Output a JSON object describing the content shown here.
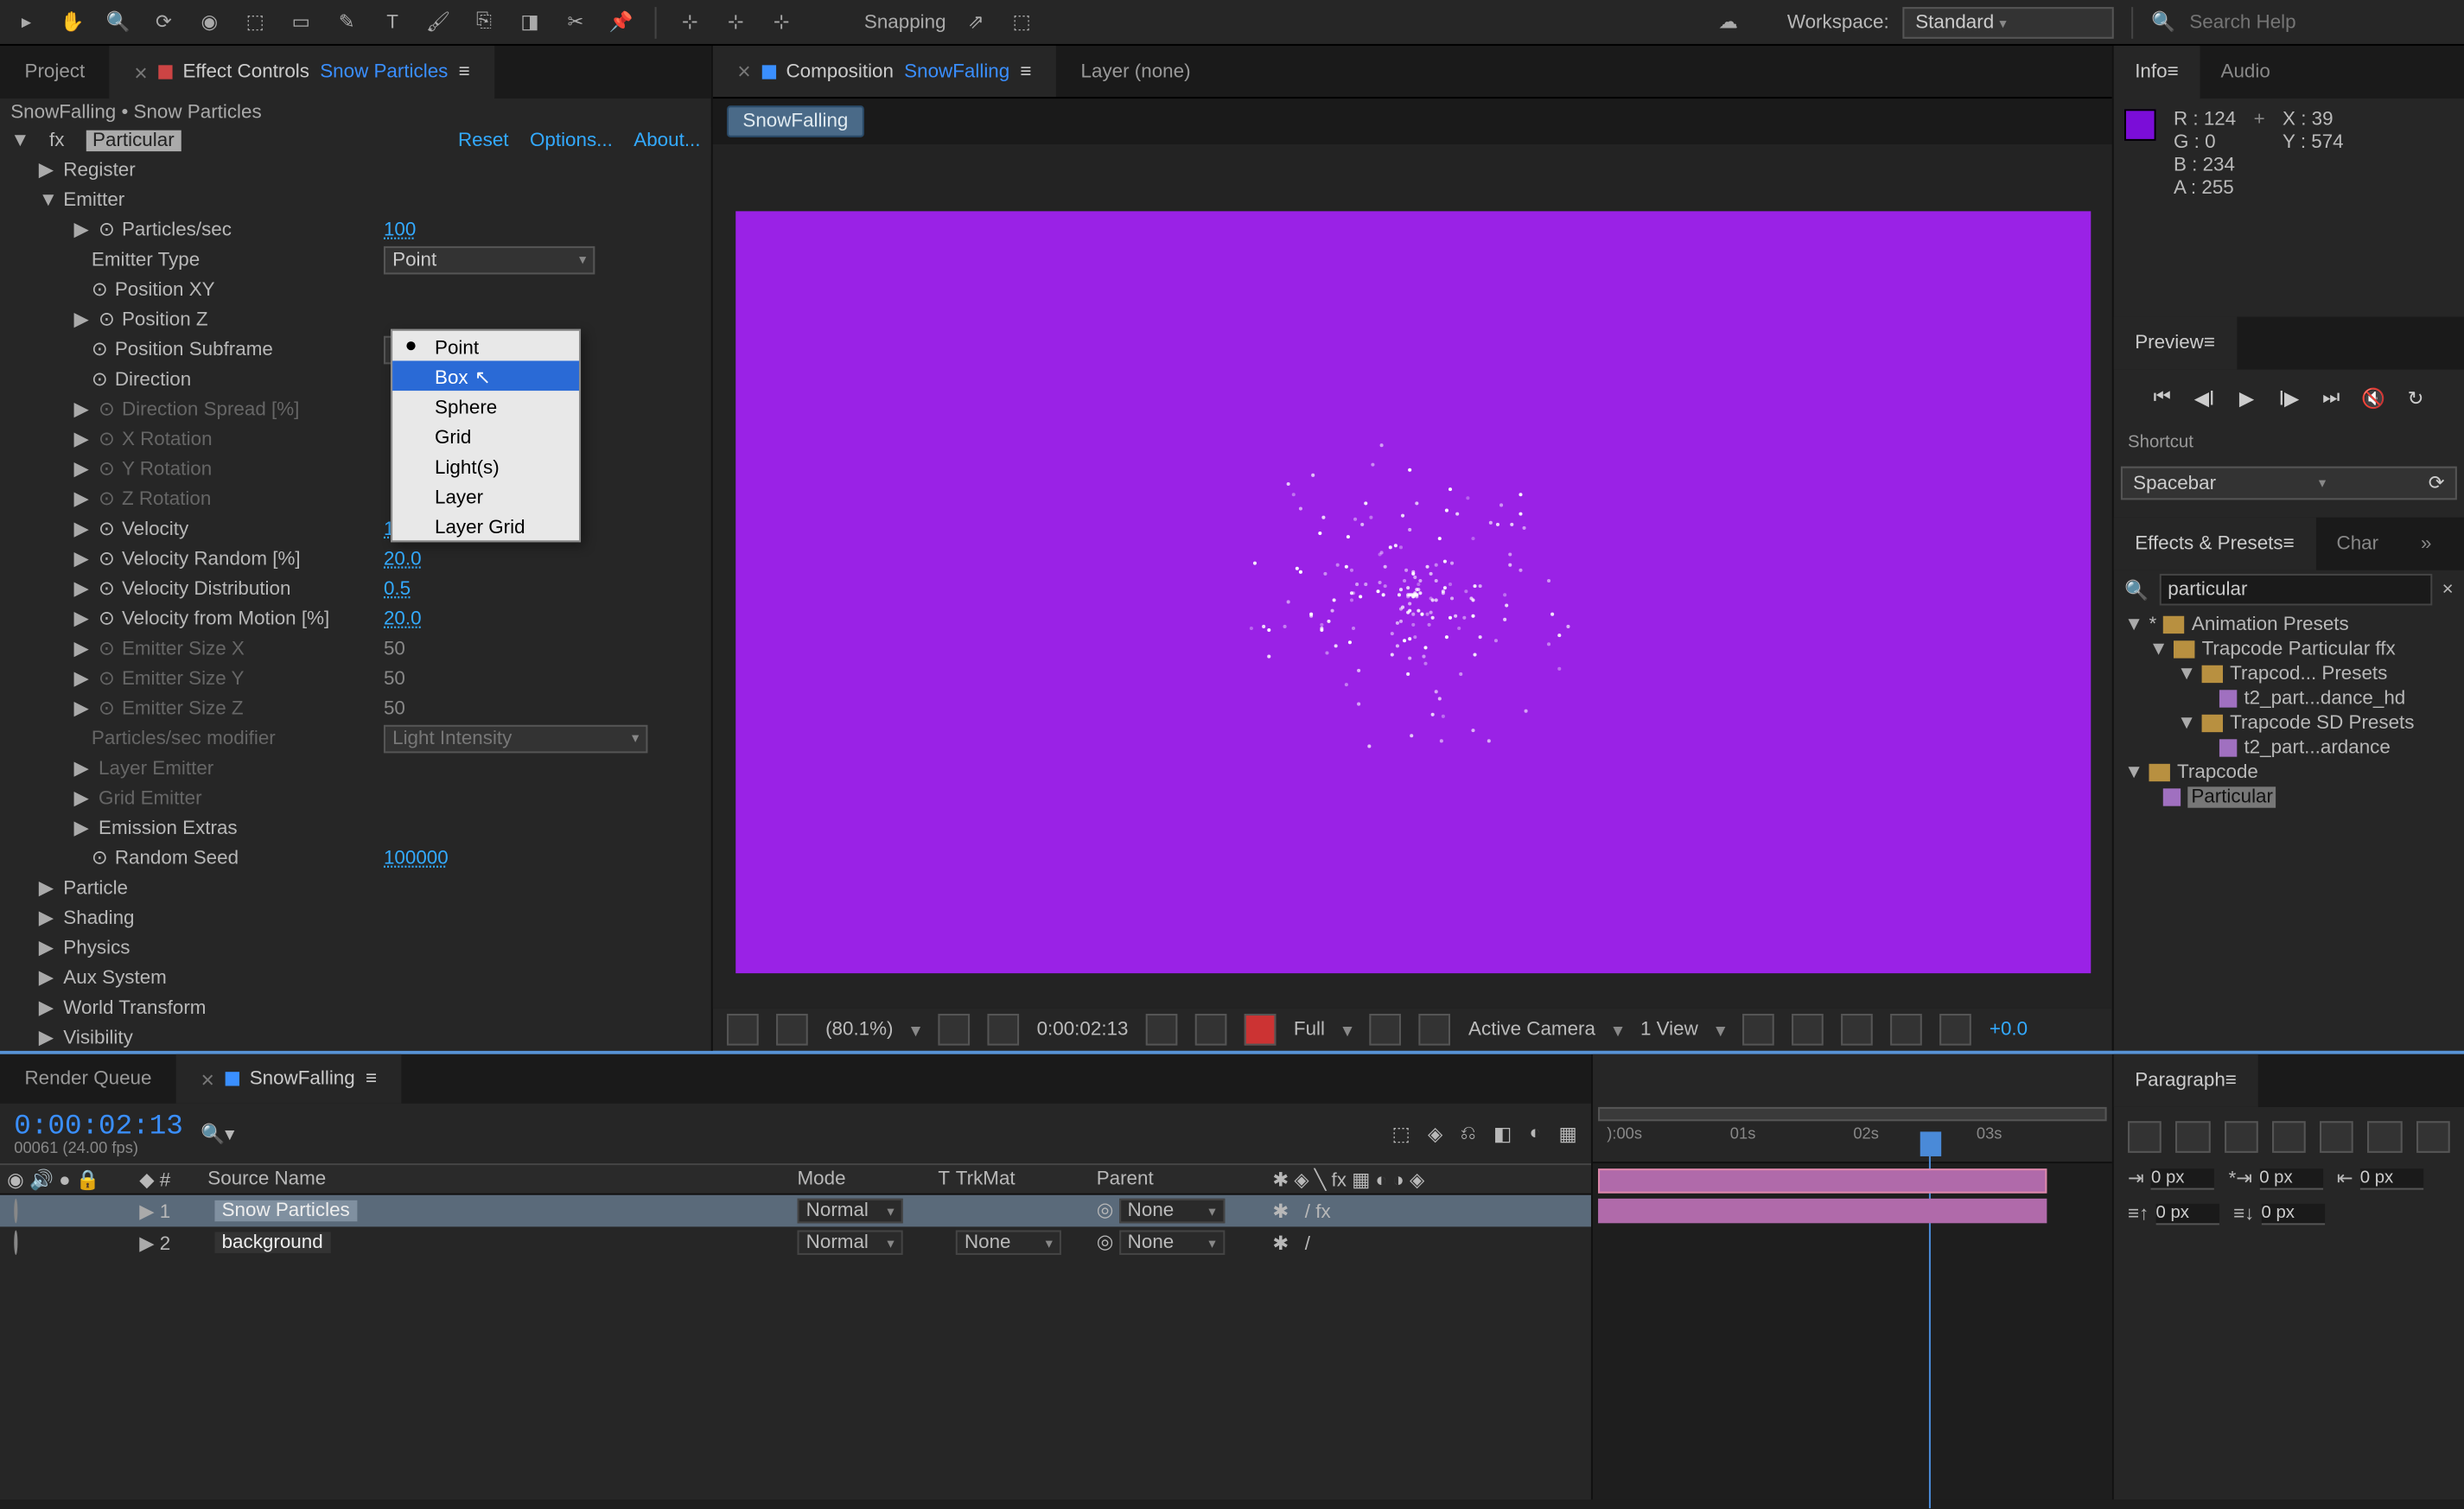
{
  "toolbar": {
    "snapping_label": "Snapping",
    "workspace_label": "Workspace:",
    "workspace_value": "Standard",
    "search_placeholder": "Search Help"
  },
  "project_tab": "Project",
  "effect_controls_tab": "Effect Controls",
  "effect_controls_layer": "Snow Particles",
  "fx_header": "SnowFalling • Snow Particles",
  "effect": {
    "name": "Particular",
    "reset": "Reset",
    "options": "Options...",
    "about": "About..."
  },
  "props": {
    "register": "Register",
    "emitter": "Emitter",
    "particles_sec": "Particles/sec",
    "particles_sec_val": "100",
    "emitter_type": "Emitter Type",
    "emitter_type_val": "Point",
    "position_xy": "Position XY",
    "position_z": "Position Z",
    "position_subframe": "Position Subframe",
    "direction": "Direction",
    "direction_spread": "Direction Spread [%]",
    "x_rotation": "X Rotation",
    "y_rotation": "Y Rotation",
    "z_rotation": "Z Rotation",
    "velocity": "Velocity",
    "velocity_val": "100.0",
    "velocity_random": "Velocity Random [%]",
    "velocity_random_val": "20.0",
    "velocity_distribution": "Velocity Distribution",
    "velocity_distribution_val": "0.5",
    "velocity_from_motion": "Velocity from Motion [%]",
    "velocity_from_motion_val": "20.0",
    "emitter_size_x": "Emitter Size X",
    "emitter_size_x_val": "50",
    "emitter_size_y": "Emitter Size Y",
    "emitter_size_y_val": "50",
    "emitter_size_z": "Emitter Size Z",
    "emitter_size_z_val": "50",
    "particles_sec_modifier": "Particles/sec modifier",
    "particles_sec_modifier_val": "Light Intensity",
    "layer_emitter": "Layer Emitter",
    "grid_emitter": "Grid Emitter",
    "emission_extras": "Emission Extras",
    "random_seed": "Random Seed",
    "random_seed_val": "100000",
    "particle": "Particle",
    "shading": "Shading",
    "physics": "Physics",
    "aux_system": "Aux System",
    "world_transform": "World Transform",
    "visibility": "Visibility"
  },
  "emitter_type_options": [
    "Point",
    "Box",
    "Sphere",
    "Grid",
    "Light(s)",
    "Layer",
    "Layer Grid"
  ],
  "comp_tab_label": "Composition",
  "comp_tab_name": "SnowFalling",
  "layer_tab": "Layer (none)",
  "flow_item": "SnowFalling",
  "viewer_footer": {
    "zoom": "(80.1%)",
    "time": "0:00:02:13",
    "res": "Full",
    "camera": "Active Camera",
    "view": "1 View",
    "exposure": "+0.0"
  },
  "info": {
    "tab_info": "Info",
    "tab_audio": "Audio",
    "r": "R : 124",
    "g": "G : 0",
    "b": "B : 234",
    "a": "A : 255",
    "x": "X : 39",
    "y": "Y : 574"
  },
  "preview": {
    "tab": "Preview"
  },
  "shortcut": {
    "label": "Shortcut",
    "value": "Spacebar"
  },
  "effects_presets": {
    "tab": "Effects & Presets",
    "tab2": "Char",
    "search": "particular",
    "tree": {
      "anim_presets": "Animation Presets",
      "trapcode_ffx": "Trapcode Particular ffx",
      "trapcode_presets": "Trapcod... Presets",
      "t2_dance_hd": "t2_part...dance_hd",
      "trapcode_sd": "Trapcode SD Presets",
      "t2_ardance": "t2_part...ardance",
      "trapcode": "Trapcode",
      "particular": "Particular"
    }
  },
  "timeline": {
    "rq_tab": "Render Queue",
    "comp_tab": "SnowFalling",
    "timecode": "0:00:02:13",
    "timecode_sub": "00061 (24.00 fps)",
    "cols": {
      "idx": "#",
      "src": "Source Name",
      "mode": "Mode",
      "t": "T",
      "trkmat": "TrkMat",
      "parent": "Parent"
    },
    "layers": [
      {
        "idx": "1",
        "name": "Snow Particles",
        "mode": "Normal",
        "trkmat": "",
        "parent": "None"
      },
      {
        "idx": "2",
        "name": "background",
        "mode": "Normal",
        "trkmat": "None",
        "parent": "None"
      }
    ],
    "ticks": [
      "):00s",
      "01s",
      "02s",
      "03s"
    ]
  },
  "paragraph": {
    "tab": "Paragraph",
    "px": "0 px"
  }
}
